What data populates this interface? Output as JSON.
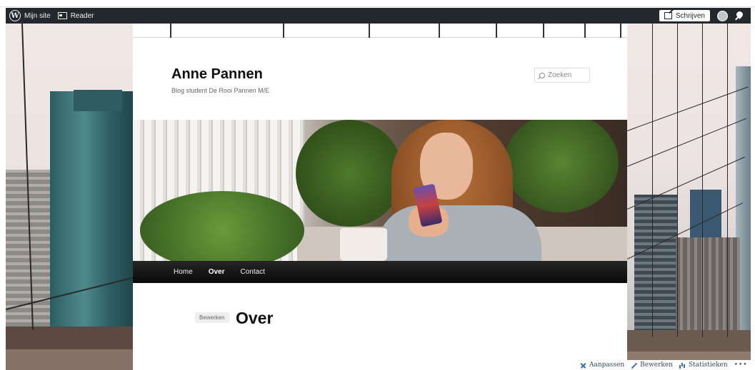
{
  "adminbar": {
    "my_site": "Mijn site",
    "reader": "Reader",
    "write": "Schrijven"
  },
  "site": {
    "title": "Anne Pannen",
    "description": "Blog student De Rooi Pannen M/E"
  },
  "search": {
    "placeholder": "Zoeken"
  },
  "nav": {
    "items": [
      {
        "label": "Home"
      },
      {
        "label": "Over"
      },
      {
        "label": "Contact"
      }
    ],
    "active": "Over"
  },
  "post": {
    "edit_label": "Bewerken",
    "title": "Over"
  },
  "actions": {
    "customize": "Aanpassen",
    "edit": "Bewerken",
    "stats": "Statistieken",
    "more": "•••"
  },
  "colors": {
    "adminbar_bg": "#23282d",
    "navbar_bg": "#0a0a0a",
    "action_icon": "#3b6db3"
  },
  "icons": {
    "wordpress": "wordpress-logo-icon",
    "reader": "reader-icon",
    "write": "write-icon",
    "avatar": "avatar",
    "notifications": "notifications-icon",
    "search": "search-icon",
    "customize": "wrench-icon",
    "edit": "pencil-icon",
    "stats": "bar-chart-icon"
  }
}
